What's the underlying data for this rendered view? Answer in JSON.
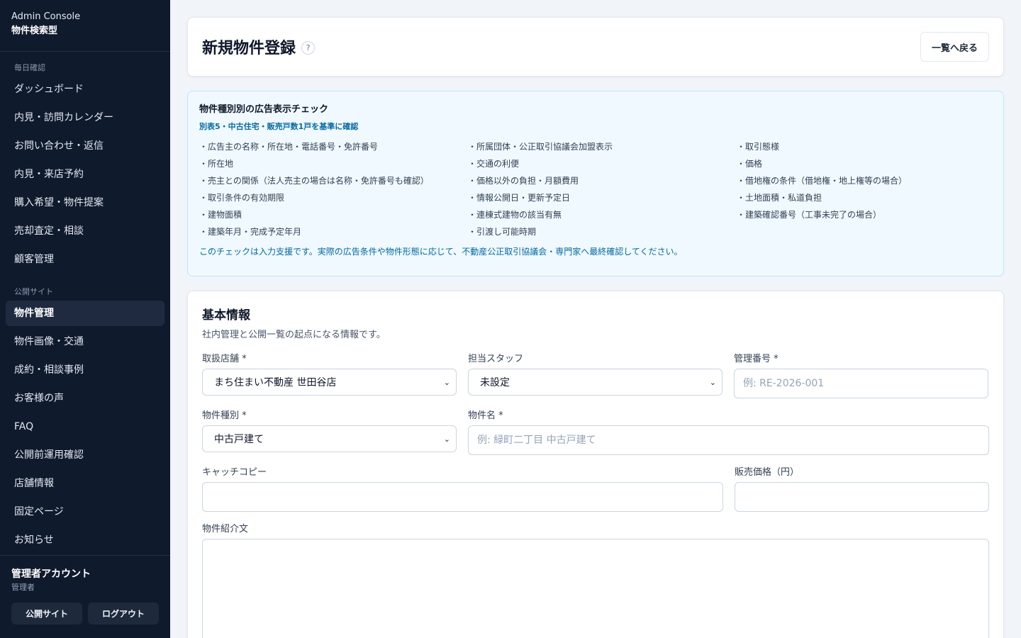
{
  "sidebar": {
    "brand_title": "Admin Console",
    "brand_subtitle": "物件検索型",
    "section_daily": "毎日確認",
    "daily_items": [
      "ダッシュボード",
      "内見・訪問カレンダー",
      "お問い合わせ・返信",
      "内見・来店予約",
      "購入希望・物件提案",
      "売却査定・相談",
      "顧客管理"
    ],
    "section_public": "公開サイト",
    "public_items": [
      "物件管理",
      "物件画像・交通",
      "成約・相談事例",
      "お客様の声",
      "FAQ",
      "公開前運用確認",
      "店舗情報",
      "固定ページ",
      "お知らせ"
    ],
    "account_name": "管理者アカウント",
    "account_role": "管理者",
    "public_site_button": "公開サイト",
    "logout_button": "ログアウト"
  },
  "header": {
    "title": "新規物件登録",
    "help": "?",
    "back_button": "一覧へ戻る"
  },
  "ad_check": {
    "title": "物件種別別の広告表示チェック",
    "subtitle": "別表5・中古住宅・販売戸数1戸を基準に確認",
    "items": [
      "・広告主の名称・所在地・電話番号・免許番号",
      "・所属団体・公正取引協議会加盟表示",
      "・取引態様",
      "・所在地",
      "・交通の利便",
      "・価格",
      "・売主との関係（法人売主の場合は名称・免許番号も確認）",
      "・価格以外の負担・月額費用",
      "・借地権の条件（借地権・地上権等の場合）",
      "・取引条件の有効期限",
      "・情報公開日・更新予定日",
      "・土地面積・私道負担",
      "・建物面積",
      "・連棟式建物の該当有無",
      "・建築確認番号（工事未完了の場合）",
      "・建築年月・完成予定年月",
      "・引渡し可能時期",
      ""
    ],
    "note": "このチェックは入力支援です。実際の広告条件や物件形態に応じて、不動産公正取引協議会・専門家へ最終確認してください。"
  },
  "basic_info": {
    "title": "基本情報",
    "description": "社内管理と公開一覧の起点になる情報です。",
    "store_label": "取扱店舗 *",
    "store_value": "まち住まい不動産 世田谷店",
    "staff_label": "担当スタッフ",
    "staff_value": "未設定",
    "mgmt_label": "管理番号 *",
    "mgmt_placeholder": "例: RE-2026-001",
    "type_label": "物件種別 *",
    "type_value": "中古戸建て",
    "name_label": "物件名 *",
    "name_placeholder": "例: 緑町二丁目 中古戸建て",
    "catch_label": "キャッチコピー",
    "price_label": "販売価格（円）",
    "intro_label": "物件紹介文"
  }
}
